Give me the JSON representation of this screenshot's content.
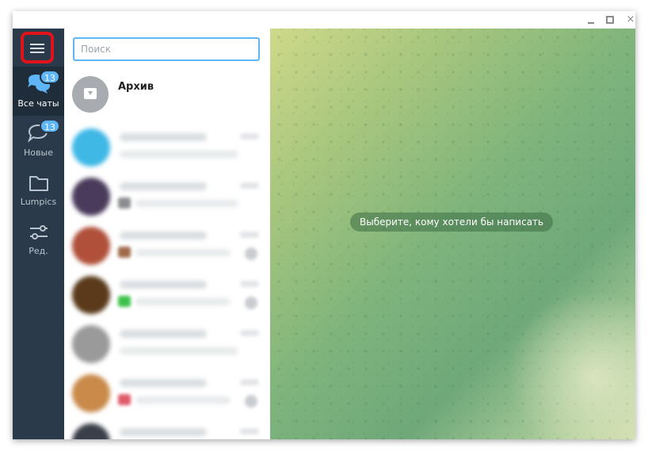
{
  "window_controls": {
    "minimize": "",
    "maximize": "",
    "close": "×"
  },
  "sidebar": {
    "menu_icon": "hamburger-menu-icon",
    "folders": [
      {
        "label": "Все чаты",
        "badge": "13",
        "icon": "chat-bubbles-icon",
        "active": true
      },
      {
        "label": "Новые",
        "badge": "13",
        "icon": "chat-bubble-icon",
        "active": false
      },
      {
        "label": "Lumpics",
        "icon": "folder-icon",
        "active": false
      },
      {
        "label": "Ред.",
        "icon": "sliders-icon",
        "active": false
      }
    ]
  },
  "chat_list": {
    "search_placeholder": "Поиск",
    "archive": {
      "title": "Архив",
      "icon": "archive-icon"
    }
  },
  "main": {
    "hint": "Выберите, кому хотели бы написать"
  },
  "colors": {
    "sidebar_bg": "#2b3a4a",
    "sidebar_active": "#1f2c39",
    "accent": "#5eb5f7",
    "highlight": "#e0121a"
  }
}
